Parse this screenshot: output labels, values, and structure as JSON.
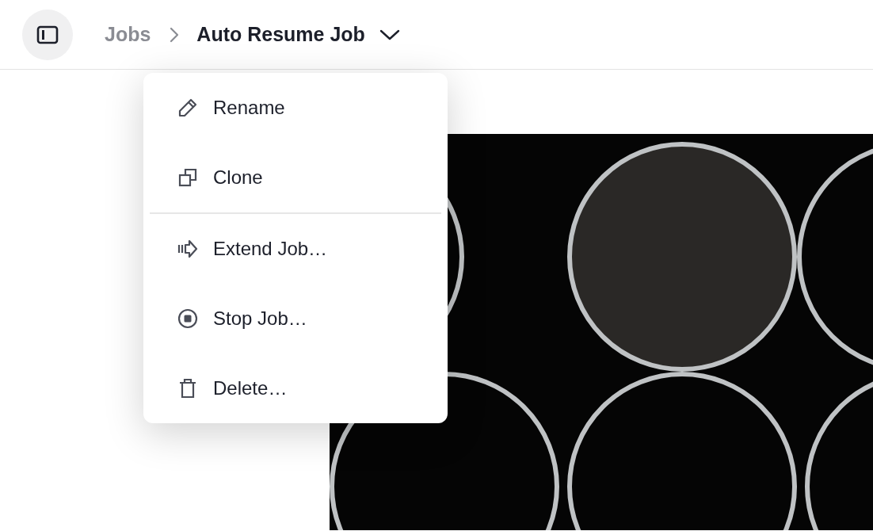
{
  "header": {
    "breadcrumb": [
      {
        "label": "Jobs"
      }
    ],
    "title": "Auto Resume Job"
  },
  "menu": {
    "groups": [
      [
        "Rename",
        "Clone"
      ],
      [
        "Extend Job…",
        "Stop Job…",
        "Delete…"
      ]
    ]
  }
}
